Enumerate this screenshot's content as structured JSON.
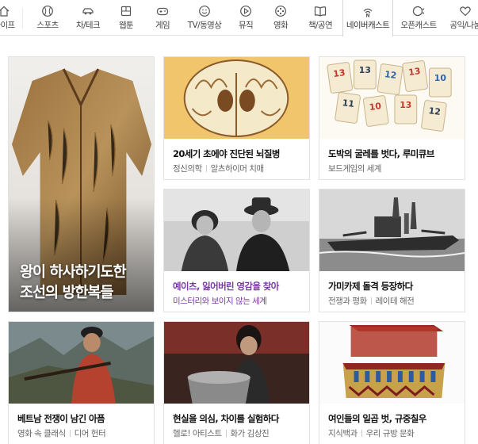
{
  "tabs": [
    {
      "label": "라이프",
      "icon": "home-icon"
    },
    {
      "label": "스포츠",
      "icon": "baseball-icon"
    },
    {
      "label": "차/테크",
      "icon": "car-icon"
    },
    {
      "label": "웹툰",
      "icon": "webtoon-icon"
    },
    {
      "label": "게임",
      "icon": "gamepad-icon"
    },
    {
      "label": "TV/동영상",
      "icon": "smile-icon"
    },
    {
      "label": "뮤직",
      "icon": "play-icon"
    },
    {
      "label": "영화",
      "icon": "film-reel-icon"
    },
    {
      "label": "책/공연",
      "icon": "book-icon"
    },
    {
      "label": "네이버캐스트",
      "icon": "naver-cast-icon",
      "active": true
    },
    {
      "label": "오픈캐스트",
      "icon": "opencast-icon"
    },
    {
      "label": "공익/나눔",
      "icon": "heart-icon"
    }
  ],
  "featured": {
    "caption_line1": "왕이 하사하기도한",
    "caption_line2": "조선의 방한복들"
  },
  "cards": [
    {
      "title": "20세기 초에야 진단된 뇌질병",
      "tags": [
        "정신의학",
        "알츠하이머 치매"
      ]
    },
    {
      "title": "도박의 굴레를 벗다, 루미큐브",
      "tags": [
        "보드게임의 세계"
      ]
    },
    {
      "title": "예이츠, 잃어버린 영감을 찾아",
      "tags": [
        "미스터리와 보이지 않는 세계"
      ]
    },
    {
      "title": "가미카제 돌격 등장하다",
      "tags": [
        "전쟁과 평화",
        "레이테 해전"
      ]
    },
    {
      "title": "베트남 전쟁이 남긴 아픔",
      "tags": [
        "영화 속 클래식",
        "디어 헌터"
      ]
    },
    {
      "title": "현실을 의심, 차이를 실험하다",
      "tags": [
        "헬로! 아티스트",
        "화가 김상진"
      ]
    },
    {
      "title": "여인들의 일곱 벗, 규중칠우",
      "tags": [
        "지식백과",
        "우리 규방 문화"
      ]
    }
  ],
  "rummikub_tiles": [
    "13",
    "13",
    "12",
    "13",
    "10",
    "11",
    "10",
    "13",
    "12"
  ],
  "colors": {
    "tab_border": "#dfdfdf",
    "purple_text": "#7b3aa3",
    "meta_text": "#666666"
  }
}
